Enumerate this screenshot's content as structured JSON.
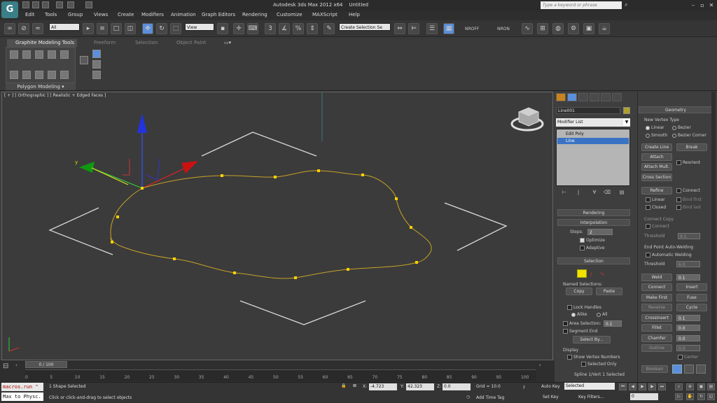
{
  "app": {
    "title": "Autodesk 3ds Max 2012 x64",
    "file": "Untitled",
    "logo": "G",
    "search_placeholder": "Type a keyword or phrase"
  },
  "menu": [
    "Edit",
    "Tools",
    "Group",
    "Views",
    "Create",
    "Modifiers",
    "Animation",
    "Graph Editors",
    "Rendering",
    "Customize",
    "MAXScript",
    "Help"
  ],
  "toolbar": {
    "filter": "All",
    "ref_coord": "View",
    "selection_set": "Create Selection Se",
    "nroff": "NROFF",
    "nron": "NRON"
  },
  "ribbon": {
    "tabs": [
      "Graphite Modeling Tools",
      "Freeform",
      "Selection",
      "Object Paint"
    ],
    "panel_label": "Polygon Modeling ▾"
  },
  "viewport": {
    "label": "[ + ] [ Orthographic ] [ Realistic + Edged Faces ]"
  },
  "command_panel": {
    "object_name": "Line001",
    "modifier_list": "Modifier List",
    "stack": [
      "Edit Poly",
      "Line"
    ],
    "rendering": "Rendering",
    "interpolation": "Interpolation",
    "steps_label": "Steps:",
    "steps_value": "2",
    "optimize": "Optimize",
    "adaptive": "Adaptive",
    "selection": "Selection",
    "named_selections": "Named Selections:",
    "copy": "Copy",
    "paste": "Paste",
    "lock_handles": "Lock Handles",
    "alike": "Alike",
    "all": "All",
    "area_selection": "Area Selection:",
    "area_value": "0.1",
    "segment_end": "Segment End",
    "select_by": "Select By...",
    "display": "Display",
    "show_vertex_numbers": "Show Vertex Numbers",
    "selected_only": "Selected Only",
    "spline_status": "Spline 1/Vert 1 Selected"
  },
  "geometry": {
    "title": "Geometry",
    "new_vertex_type": "New Vertex Type",
    "linear": "Linear",
    "bezier": "Bezier",
    "smooth": "Smooth",
    "bezier_corner": "Bezier Corner",
    "create_line": "Create Line",
    "break": "Break",
    "attach": "Attach",
    "reorient": "Reorient",
    "attach_mult": "Attach Mult.",
    "cross_section": "Cross Section",
    "refine": "Refine",
    "connect": "Connect",
    "linear2": "Linear",
    "bind_first": "Bind first",
    "closed": "Closed",
    "bind_last": "Bind last",
    "connect_copy": "Connect Copy",
    "connect2": "Connect",
    "threshold": "Threshold",
    "threshold_value": "0.1",
    "end_point_welding": "End Point Auto-Welding",
    "automatic_welding": "Automatic Welding",
    "threshold2": "Threshold",
    "threshold2_value": "6.0",
    "weld": "Weld",
    "weld_value": "0.1",
    "connect3": "Connect",
    "insert": "Insert",
    "make_first": "Make First",
    "fuse": "Fuse",
    "reverse": "Reverse",
    "cycle": "Cycle",
    "crossinsert": "CrossInsert",
    "crossinsert_value": "0.1",
    "fillet": "Fillet",
    "fillet_value": "0.0",
    "chamfer": "Chamfer",
    "chamfer_value": "0.0",
    "outline": "Outline",
    "outline_value": "0.0",
    "center": "Center",
    "boolean": "Boolean"
  },
  "timeline": {
    "slider": "0 / 100",
    "ticks": [
      "0",
      "5",
      "10",
      "15",
      "20",
      "25",
      "30",
      "35",
      "40",
      "45",
      "50",
      "55",
      "60",
      "65",
      "70",
      "75",
      "80",
      "85",
      "90",
      "95",
      "100"
    ]
  },
  "status": {
    "macro1": "macros.run \"",
    "macro2": "Max to Physc.",
    "selected": "1 Shape Selected",
    "prompt": "Click or click-and-drag to select objects",
    "x_label": "X:",
    "x": "-4.723",
    "y_label": "Y:",
    "y": "42.323",
    "z_label": "Z:",
    "z": "0.0",
    "grid": "Grid = 10.0",
    "add_time_tag": "Add Time Tag",
    "auto_key": "Auto Key",
    "set_key": "Set Key",
    "key_mode": "Selected",
    "key_filters": "Key Filters...",
    "frame": "0"
  }
}
